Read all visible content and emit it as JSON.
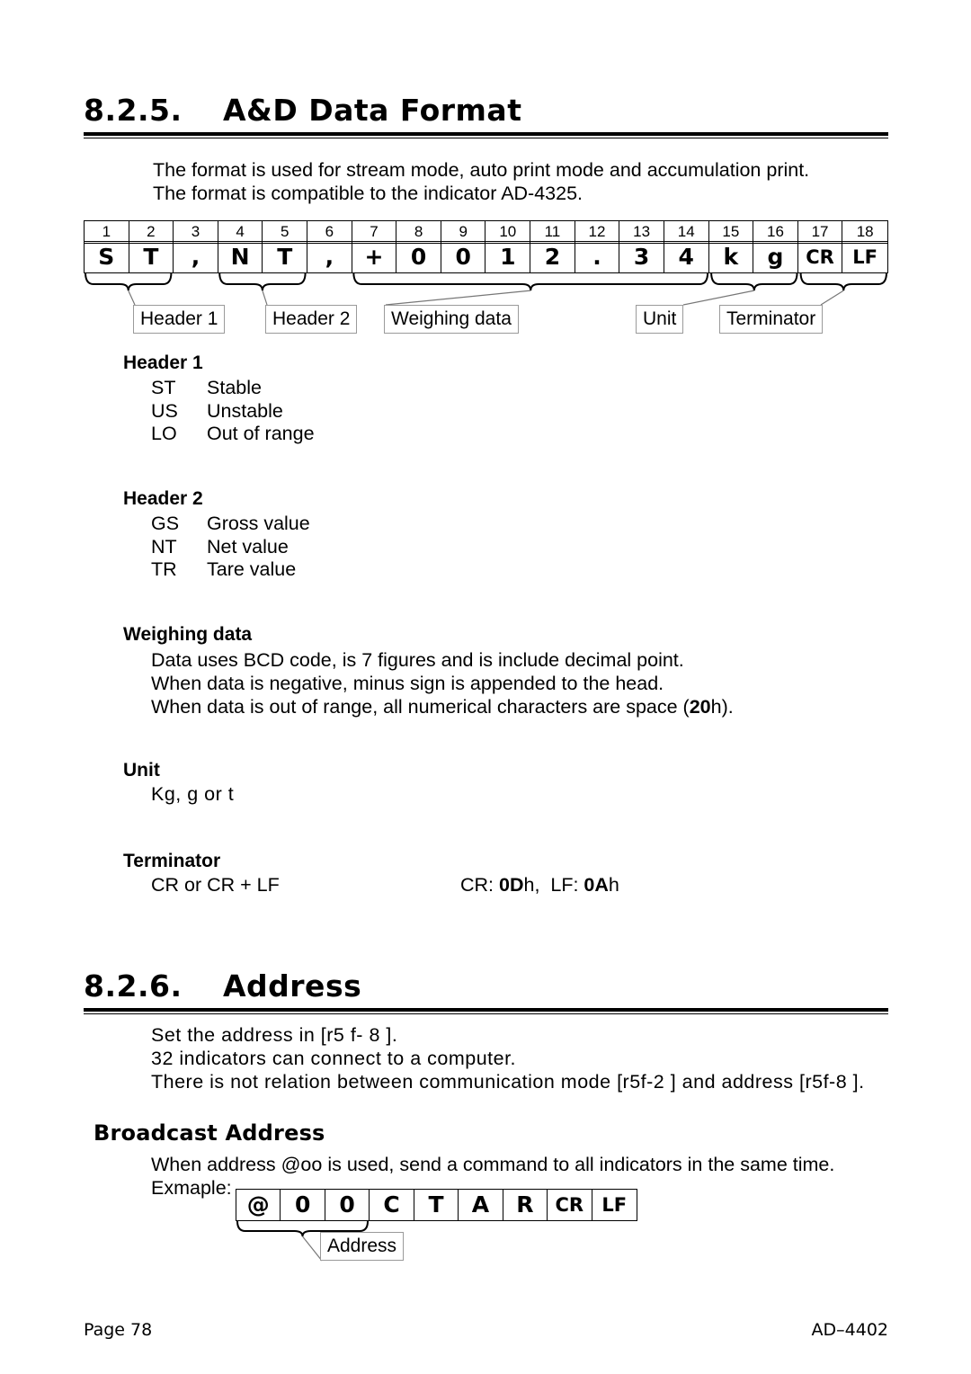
{
  "sections": [
    {
      "number": "8.2.5.",
      "title": "A&D Data Format",
      "intro": [
        "The format is used for stream mode, auto print mode and accumulation print.",
        "The format is compatible to the indicator AD-4325."
      ]
    },
    {
      "number": "8.2.6.",
      "title": "Address",
      "intro": [
        "Set the address in [r5 f- 8    ].",
        "32 indicators can connect to a computer.",
        "There is not relation between communication mode [r5f-2    ] and address [r5f-8    ]."
      ]
    }
  ],
  "format_table": {
    "indices": [
      "1",
      "2",
      "3",
      "4",
      "5",
      "6",
      "7",
      "8",
      "9",
      "10",
      "11",
      "12",
      "13",
      "14",
      "15",
      "16",
      "17",
      "18"
    ],
    "values": [
      "S",
      "T",
      ",",
      "N",
      "T",
      ",",
      "+",
      "0",
      "0",
      "1",
      "2",
      ".",
      "3",
      "4",
      "k",
      "g",
      "CR",
      "LF"
    ],
    "callouts": [
      {
        "label": "Header 1",
        "from": 1,
        "to": 2
      },
      {
        "label": "Header 2",
        "from": 4,
        "to": 5
      },
      {
        "label": "Weighing data",
        "from": 7,
        "to": 14
      },
      {
        "label": "Unit",
        "from": 15,
        "to": 16
      },
      {
        "label": "Terminator",
        "from": 17,
        "to": 18
      }
    ]
  },
  "definitions": [
    {
      "title": "Header 1",
      "rows": [
        {
          "code": "ST",
          "meaning": "Stable"
        },
        {
          "code": "US",
          "meaning": "Unstable"
        },
        {
          "code": "LO",
          "meaning": "Out of range"
        }
      ]
    },
    {
      "title": "Header 2",
      "rows": [
        {
          "code": "GS",
          "meaning": "Gross value"
        },
        {
          "code": "NT",
          "meaning": "Net value"
        },
        {
          "code": "TR",
          "meaning": "Tare value"
        }
      ]
    }
  ],
  "weighing_data": {
    "title": "Weighing data",
    "lines": [
      "Data uses BCD code, is 7 figures and is include decimal point.",
      "When data is negative, minus sign is appended to the head.",
      "When data is out of range, all numerical characters are space (20h)."
    ],
    "line3_prefix": "When data is out of range, all numerical characters are space (",
    "line3_bold": "20",
    "line3_suffix": "h)."
  },
  "unit": {
    "title": "Unit",
    "value": "Kg,  g or  t"
  },
  "terminator": {
    "title": "Terminator",
    "left": "CR or CR + LF",
    "right_cr_label": "CR: ",
    "right_cr_bold": "0D",
    "right_cr_suffix": "h,",
    "right_lf_label": "LF: ",
    "right_lf_bold": "0A",
    "right_lf_suffix": "h"
  },
  "broadcast": {
    "title": "Broadcast Address",
    "lines": [
      "When address @oo is used, send a command to all indicators in the same time.",
      "Exmaple:"
    ],
    "example_table": {
      "values": [
        "@",
        "0",
        "0",
        "C",
        "T",
        "A",
        "R",
        "CR",
        "LF"
      ],
      "callouts": [
        {
          "label": "Address",
          "from": 1,
          "to": 3
        }
      ]
    }
  },
  "footer": {
    "page": "Page 78",
    "model": "AD–4402"
  }
}
